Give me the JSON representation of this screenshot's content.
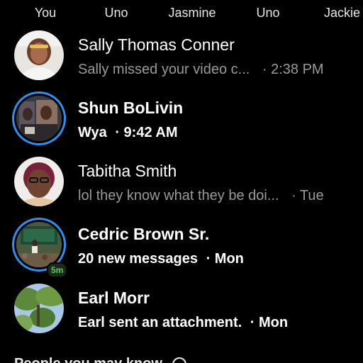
{
  "active_now": [
    {
      "name": "You"
    },
    {
      "name": "Uno"
    },
    {
      "name": "Jasmine"
    },
    {
      "name": "Uno"
    },
    {
      "name": "Jackie"
    }
  ],
  "chats": [
    {
      "name": "Sally Thomas Conner",
      "snippet": "Sally missed your video c...",
      "time": "· 2:38 PM",
      "unread": false,
      "has_story": false
    },
    {
      "name": "Shun BoLivin",
      "snippet": "Wya",
      "time": "· 9:42 AM",
      "unread": true,
      "has_story": true
    },
    {
      "name": "Tabitha Smith",
      "snippet": "lol they know what they be doi...",
      "time": "· Tue",
      "unread": false,
      "has_story": false
    },
    {
      "name": "Cedric Brown Sr.",
      "snippet": "20 new messages",
      "time": "· Mon",
      "unread": true,
      "has_story": true,
      "active_badge": "5m"
    },
    {
      "name": "Earl Morr",
      "snippet": "Earl sent an attachment.",
      "time": "· Mon",
      "unread": true,
      "has_story": false
    }
  ],
  "section": {
    "title": "People you may know"
  },
  "colors": {
    "background": "#000000",
    "story_ring": "#2f8ff0",
    "active_green": "#4fd35f",
    "muted_text": "#9a9a9a"
  }
}
